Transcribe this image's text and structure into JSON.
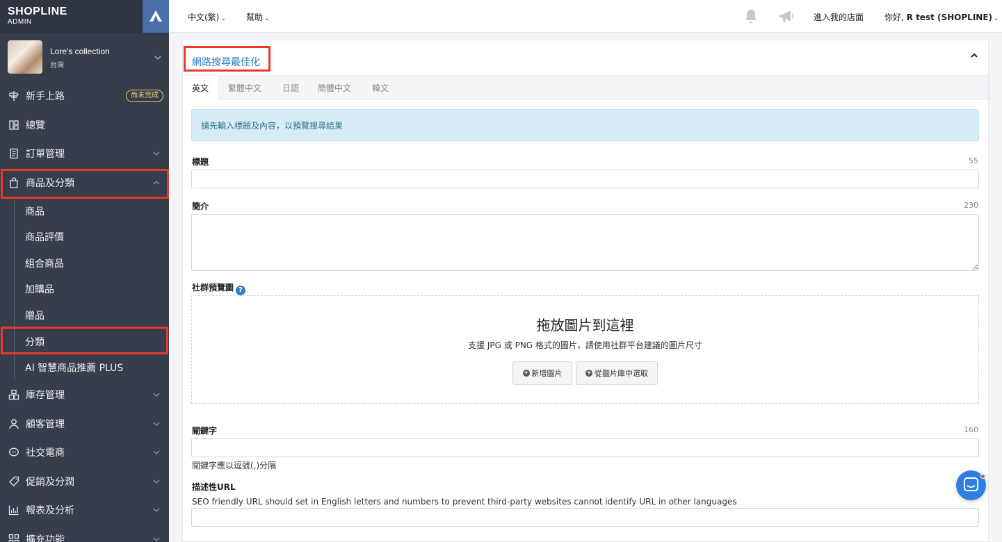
{
  "brand": {
    "name": "SHOPLINE",
    "sub": "ADMIN"
  },
  "store": {
    "name": "Lore's collection",
    "region": "台灣"
  },
  "nav": [
    {
      "label": "新手上路",
      "icon": "signpost-icon",
      "badge": "尚未完成"
    },
    {
      "label": "總覽",
      "icon": "dashboard-icon"
    },
    {
      "label": "訂單管理",
      "icon": "order-icon"
    },
    {
      "label": "商品及分類",
      "icon": "shopping-bag-icon"
    },
    {
      "label": "庫存管理",
      "icon": "inventory-icon"
    },
    {
      "label": "顧客管理",
      "icon": "customer-icon"
    },
    {
      "label": "社交電商",
      "icon": "chat-bubble-icon"
    },
    {
      "label": "促銷及分潤",
      "icon": "tag-icon"
    },
    {
      "label": "報表及分析",
      "icon": "chart-icon"
    },
    {
      "label": "擴充功能",
      "icon": "apps-icon"
    }
  ],
  "subnav": [
    "商品",
    "商品評價",
    "組合商品",
    "加購品",
    "贈品",
    "分類",
    "AI 智慧商品推薦 PLUS"
  ],
  "topbar": {
    "language": "中文(繁)",
    "help": "幫助",
    "visit_store": "進入我的店面",
    "greeting_prefix": "你好,",
    "user": "R test (SHOPLINE)"
  },
  "seo": {
    "title": "網路搜尋最佳化",
    "tabs": [
      "英文",
      "繁體中文",
      "日語",
      "簡體中文",
      "韓文"
    ],
    "info": "請先輸入標題及內容，以預覽搜尋結果",
    "title_label": "標題",
    "title_limit": "55",
    "title_value": "",
    "desc_label": "簡介",
    "desc_limit": "230",
    "desc_value": "",
    "social_label": "社群預覽圖",
    "help_glyph": "?",
    "drop_title": "拖放圖片到這裡",
    "drop_sub": "支援 JPG 或 PNG 格式的圖片，請使用社群平台建議的圖片尺寸",
    "add_image": "新增圖片",
    "choose_library": "從圖片庫中選取",
    "keywords_label": "關鍵字",
    "keywords_limit": "160",
    "keywords_value": "",
    "keywords_note": "關鍵字應以逗號(,)分隔",
    "url_label": "描述性URL",
    "url_note": "SEO friendly URL should set in English letters and numbers to prevent third-party websites cannot identify URL in other languages",
    "url_value": ""
  },
  "colors": {
    "sidebar": "#373d4b",
    "accent": "#2a7bc0",
    "highlight": "#e53a2c",
    "info_bg": "#d7ecf5"
  }
}
